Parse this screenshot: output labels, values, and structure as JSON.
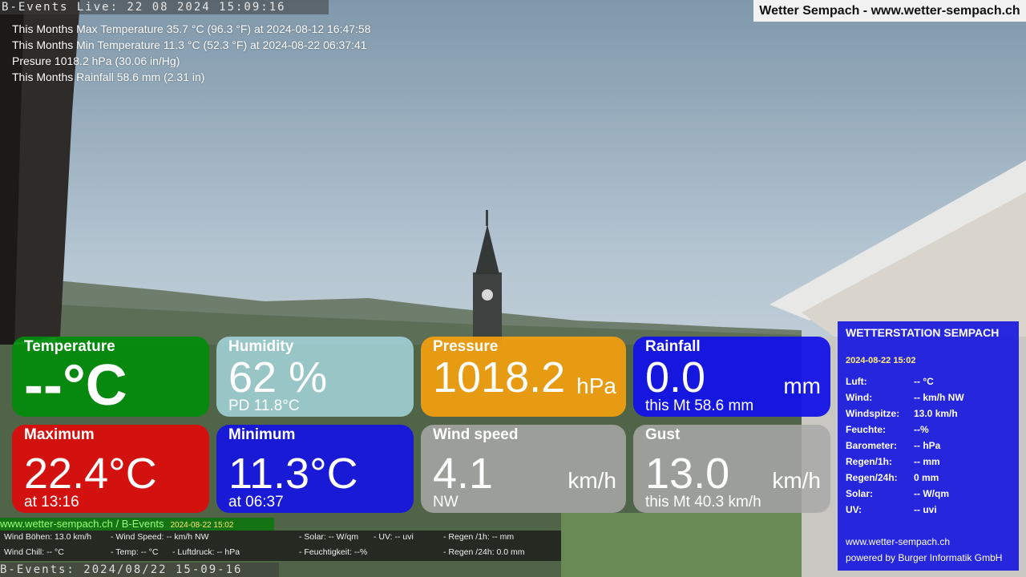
{
  "header": {
    "live_bar": "B-Events Live: 22 08 2024 15:09:16",
    "site_title": "Wetter Sempach - www.wetter-sempach.ch"
  },
  "stats": [
    "This Months Max Temperature 35.7 °C (96.3 °F) at 2024-08-12 16:47:58",
    "This Months Min Temperature 11.3 °C (52.3 °F) at 2024-08-22 06:37:41",
    "Presure 1018.2 hPa (30.06 in/Hg)",
    "This Months Rainfall 58.6 mm (2.31 in)"
  ],
  "tiles": {
    "temperature": {
      "title": "Temperature",
      "value": "--°C"
    },
    "humidity": {
      "title": "Humidity",
      "value": "62 %",
      "sub": "PD 11.8°C"
    },
    "pressure": {
      "title": "Pressure",
      "value": "1018.2",
      "unit": "hPa"
    },
    "rainfall": {
      "title": "Rainfall",
      "value": "0.0",
      "unit": "mm",
      "sub": "this Mt 58.6 mm"
    },
    "maximum": {
      "title": "Maximum",
      "value": "22.4°C",
      "sub": "at 13:16"
    },
    "minimum": {
      "title": "Minimum",
      "value": "11.3°C",
      "sub": "at 06:37"
    },
    "wind_speed": {
      "title": "Wind speed",
      "value": "4.1",
      "unit": "km/h",
      "sub": "NW"
    },
    "gust": {
      "title": "Gust",
      "value": "13.0",
      "unit": "km/h",
      "sub": "this Mt 40.3 km/h"
    }
  },
  "panel": {
    "title": "WETTERSTATION SEMPACH",
    "date": "2024-08-22 15:02",
    "rows": [
      {
        "k": "Luft:",
        "v": "-- °C"
      },
      {
        "k": "Wind:",
        "v": "-- km/h  NW"
      },
      {
        "k": "Windspitze:",
        "v": "13.0 km/h"
      },
      {
        "k": "Feuchte:",
        "v": "--%"
      },
      {
        "k": "Barometer:",
        "v": "-- hPa"
      },
      {
        "k": "Regen/1h:",
        "v": "-- mm"
      },
      {
        "k": "Regen/24h:",
        "v": "0 mm"
      },
      {
        "k": "Solar:",
        "v": "-- W/qm"
      },
      {
        "k": "UV:",
        "v": "-- uvi"
      }
    ],
    "footer_site": "www.wetter-sempach.ch",
    "footer_credit": "powered by Burger Informatik GmbH"
  },
  "ticker": {
    "head": "www.wetter-sempach.ch / B-Events",
    "date": "2024-08-22 15:02",
    "row1": [
      "Wind Böhen: 13.0 km/h",
      "- Wind Speed: -- km/h NW",
      "- Solar: -- W/qm",
      "- UV: -- uvi",
      "- Regen /1h:   -- mm"
    ],
    "row2": [
      "Wind Chill: -- °C",
      "- Temp: -- °C",
      "- Luftdruck: -- hPa",
      "- Feuchtigkeit: --%",
      "- Regen /24h: 0.0 mm"
    ]
  },
  "bottom_bar": "B-Events: 2024/08/22 15-09-16",
  "colors": {
    "temperature": "#008c0a",
    "humidity": "#a5d7de",
    "pressure": "#ee9e10",
    "rainfall": "#1212e8",
    "maximum": "#de0c0c",
    "minimum": "#1616de",
    "wind": "#a8a8a8",
    "panel": "#1c1cde"
  }
}
